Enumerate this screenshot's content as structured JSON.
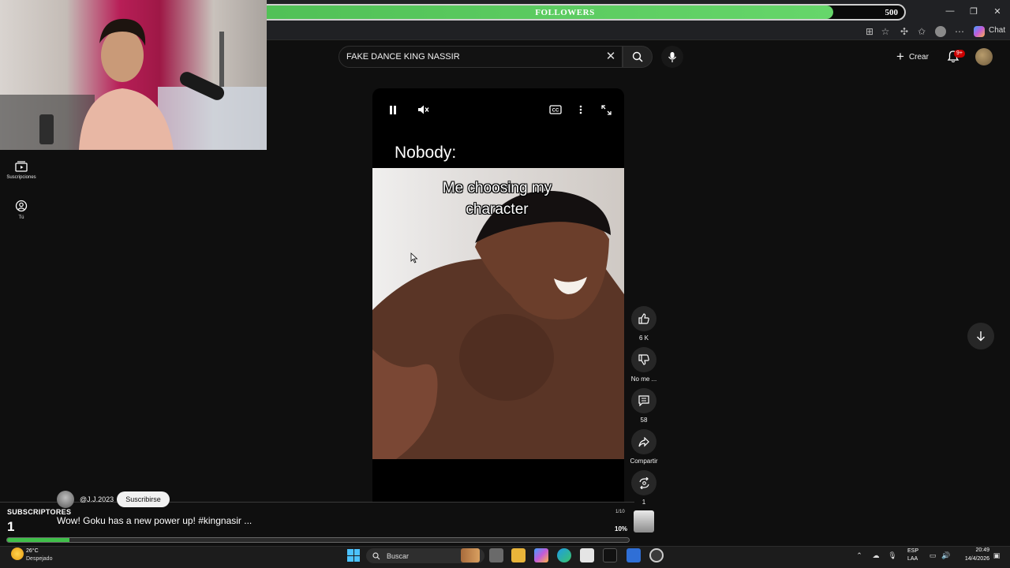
{
  "followers_overlay": {
    "current": "448",
    "label": "FOLLOWERS",
    "goal": "500",
    "progress_fraction": 0.896
  },
  "browser": {
    "chat_label": "Chat"
  },
  "youtube": {
    "search_query": "FAKE DANCE KING NASSIR",
    "create_label": "Crear",
    "notification_badge": "9+",
    "sidebar": [
      {
        "label": "Suscripciones",
        "icon": "subscriptions-icon"
      },
      {
        "label": "Tú",
        "icon": "you-icon"
      }
    ],
    "short": {
      "top_text": "Nobody:",
      "caption": "Me choosing my character"
    },
    "actions": {
      "like_count": "6 K",
      "dislike_label": "No me ...",
      "comments_count": "58",
      "share_label": "Compartir",
      "remix_count": "1"
    }
  },
  "subscriber_overlay": {
    "title": "SUBSCRIPTORES",
    "count": "1",
    "video_title": "Wow! Goku has a new power up! #kingnasir ...",
    "page_counter": "1/10",
    "percent": "10%",
    "progress_fraction": 0.1,
    "channel_handle": "@J.J.2023",
    "subscribe_label": "Suscribirse"
  },
  "taskbar": {
    "temperature": "26°C",
    "weather": "Despejado",
    "search_label": "Buscar",
    "lang_1": "ESP",
    "lang_2": "LAA",
    "time": "20:49",
    "date": "14/4/2026"
  },
  "colors": {
    "accent_green": "#4fbf55",
    "youtube_red": "#cc0000",
    "windows_blue": "#4cc2ff"
  }
}
